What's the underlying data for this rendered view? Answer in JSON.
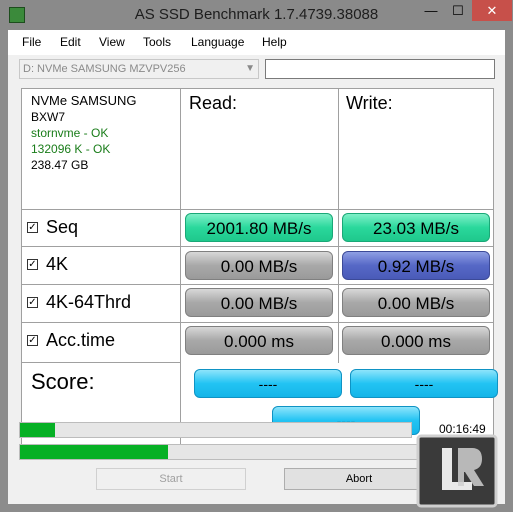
{
  "window": {
    "title": "AS SSD Benchmark 1.7.4739.38088",
    "minimize": "—",
    "maximize": "☐",
    "close": "✕"
  },
  "menu": [
    "File",
    "Edit",
    "View",
    "Tools",
    "Language",
    "Help"
  ],
  "drive": {
    "selected": "D: NVMe SAMSUNG MZVPV256",
    "extra_field": ""
  },
  "device": {
    "name": "NVMe SAMSUNG",
    "model": "BXW7",
    "driver": "stornvme - OK",
    "alignment": "132096 K - OK",
    "size": "238.47 GB"
  },
  "columns": {
    "read": "Read:",
    "write": "Write:"
  },
  "rows": [
    {
      "label": "Seq",
      "checked": true,
      "read": "2001.80 MB/s",
      "write": "23.03 MB/s",
      "read_color": "green",
      "write_color": "green"
    },
    {
      "label": "4K",
      "checked": true,
      "read": "0.00 MB/s",
      "write": "0.92 MB/s",
      "read_color": "gray",
      "write_color": "blue"
    },
    {
      "label": "4K-64Thrd",
      "checked": true,
      "read": "0.00 MB/s",
      "write": "0.00 MB/s",
      "read_color": "gray",
      "write_color": "gray"
    },
    {
      "label": "Acc.time",
      "checked": true,
      "read": "0.000 ms",
      "write": "0.000 ms",
      "read_color": "gray",
      "write_color": "gray"
    }
  ],
  "score": {
    "label": "Score:",
    "read": "----",
    "write": "----",
    "total": "----"
  },
  "progress": {
    "test_fraction": 0.09,
    "total_fraction": 0.32,
    "elapsed": "00:16:49"
  },
  "buttons": {
    "start": "Start",
    "abort": "Abort"
  },
  "colors": {
    "titlebar": "#8a8a8a",
    "progress": "#06b025",
    "green": "#2ad89c",
    "blue": "#5668c6",
    "cyan": "#22c3f3",
    "gray": "#a8a8a8"
  },
  "logo": {
    "icon": "legit-reviews-logo"
  }
}
